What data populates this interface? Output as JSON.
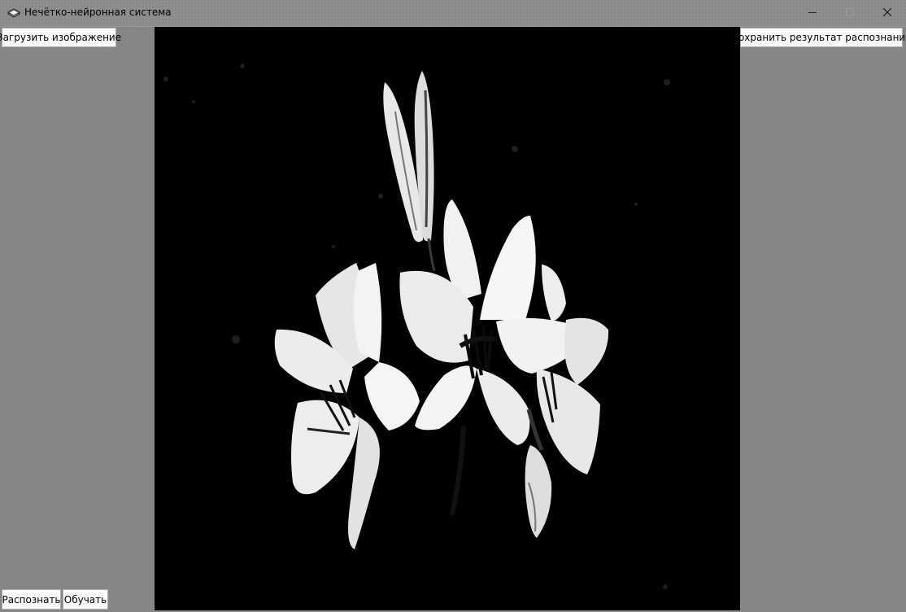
{
  "window": {
    "title": "Нечётко-нейронная система",
    "app_icon": "stack-icon",
    "controls": [
      "minimize-icon",
      "maximize-icon",
      "close-icon"
    ]
  },
  "toolbar": {
    "load_label": "Загрузить изображение",
    "save_label": "Сохранить результат распознания"
  },
  "bottom_bar": {
    "recognize_label": "Распознать",
    "train_label": "Обучать"
  },
  "image_panel": {
    "content": "white lily flowers on black background",
    "colors": {
      "background": "#000000",
      "petal": "#f2f2f2"
    }
  },
  "colors": {
    "window_bg": "#868686",
    "button_bg": "#fbfbfb",
    "button_border": "#adadad"
  }
}
